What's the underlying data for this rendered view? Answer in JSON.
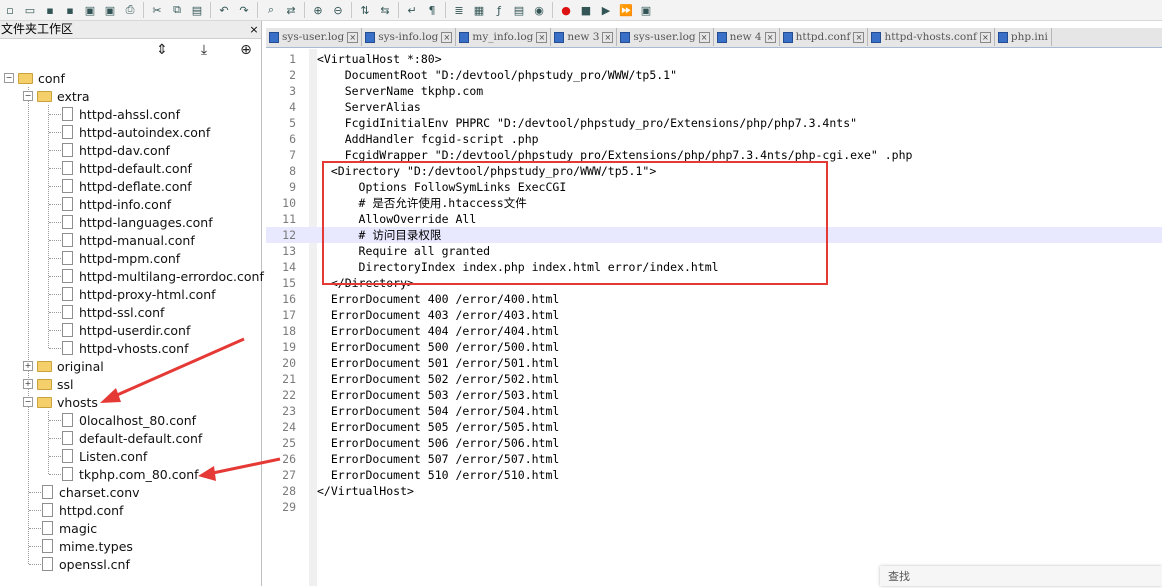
{
  "toolbar": {
    "icons": [
      "new-file-icon",
      "open-file-icon",
      "save-icon",
      "save-all-icon",
      "close-icon",
      "close-all-icon",
      "print-icon",
      "cut-icon",
      "copy-icon",
      "paste-icon",
      "undo-icon",
      "redo-icon",
      "find-icon",
      "replace-icon",
      "zoom-in-icon",
      "zoom-out-icon",
      "sync-v-icon",
      "sync-h-icon",
      "word-wrap-icon",
      "show-all-icon",
      "indent-guide-icon",
      "doc-map-icon",
      "function-list-icon",
      "folder-workspace-icon",
      "monitor-icon",
      "record-macro-icon",
      "stop-macro-icon",
      "play-macro-icon",
      "run-macro-multi-icon",
      "save-macro-icon"
    ]
  },
  "panel": {
    "title": "文件夹工作区",
    "close": "×",
    "tools": [
      "⇕",
      "⤓",
      "⊕"
    ],
    "tree": [
      {
        "label": "conf",
        "type": "folder",
        "expander": "−"
      },
      {
        "label": "extra",
        "type": "folder",
        "expander": "−"
      },
      {
        "label": "httpd-ahssl.conf",
        "type": "file"
      },
      {
        "label": "httpd-autoindex.conf",
        "type": "file"
      },
      {
        "label": "httpd-dav.conf",
        "type": "file"
      },
      {
        "label": "httpd-default.conf",
        "type": "file"
      },
      {
        "label": "httpd-deflate.conf",
        "type": "file"
      },
      {
        "label": "httpd-info.conf",
        "type": "file"
      },
      {
        "label": "httpd-languages.conf",
        "type": "file"
      },
      {
        "label": "httpd-manual.conf",
        "type": "file"
      },
      {
        "label": "httpd-mpm.conf",
        "type": "file"
      },
      {
        "label": "httpd-multilang-errordoc.conf",
        "type": "file"
      },
      {
        "label": "httpd-proxy-html.conf",
        "type": "file"
      },
      {
        "label": "httpd-ssl.conf",
        "type": "file"
      },
      {
        "label": "httpd-userdir.conf",
        "type": "file"
      },
      {
        "label": "httpd-vhosts.conf",
        "type": "file"
      },
      {
        "label": "original",
        "type": "folder",
        "expander": "+"
      },
      {
        "label": "ssl",
        "type": "folder",
        "expander": "+"
      },
      {
        "label": "vhosts",
        "type": "folder",
        "expander": "−"
      },
      {
        "label": "0localhost_80.conf",
        "type": "file"
      },
      {
        "label": "default-default.conf",
        "type": "file"
      },
      {
        "label": "Listen.conf",
        "type": "file"
      },
      {
        "label": "tkphp.com_80.conf",
        "type": "file"
      },
      {
        "label": "charset.conv",
        "type": "file"
      },
      {
        "label": "httpd.conf",
        "type": "file"
      },
      {
        "label": "magic",
        "type": "file"
      },
      {
        "label": "mime.types",
        "type": "file"
      },
      {
        "label": "openssl.cnf",
        "type": "file"
      }
    ]
  },
  "tabs": [
    {
      "label": "sys-user.log"
    },
    {
      "label": "sys-info.log"
    },
    {
      "label": "my_info.log"
    },
    {
      "label": "new 3"
    },
    {
      "label": "sys-user.log"
    },
    {
      "label": "new 4"
    },
    {
      "label": "httpd.conf"
    },
    {
      "label": "httpd-vhosts.conf"
    },
    {
      "label": "php.ini"
    }
  ],
  "tab_close": "×",
  "editor": {
    "current_line": 12,
    "lines": [
      {
        "n": "1",
        "text": "<VirtualHost *:80>"
      },
      {
        "n": "2",
        "text": "    DocumentRoot \"D:/devtool/phpstudy_pro/WWW/tp5.1\""
      },
      {
        "n": "3",
        "text": "    ServerName tkphp.com"
      },
      {
        "n": "4",
        "text": "    ServerAlias"
      },
      {
        "n": "5",
        "text": "    FcgidInitialEnv PHPRC \"D:/devtool/phpstudy_pro/Extensions/php/php7.3.4nts\""
      },
      {
        "n": "6",
        "text": "    AddHandler fcgid-script .php"
      },
      {
        "n": "7",
        "text": "    FcgidWrapper \"D:/devtool/phpstudy_pro/Extensions/php/php7.3.4nts/php-cgi.exe\" .php"
      },
      {
        "n": "8",
        "text": "  <Directory \"D:/devtool/phpstudy_pro/WWW/tp5.1\">"
      },
      {
        "n": "9",
        "text": "      Options FollowSymLinks ExecCGI"
      },
      {
        "n": "10",
        "text": "      # 是否允许使用.htaccess文件"
      },
      {
        "n": "11",
        "text": "      AllowOverride All"
      },
      {
        "n": "12",
        "text": "      # 访问目录权限"
      },
      {
        "n": "13",
        "text": "      Require all granted"
      },
      {
        "n": "14",
        "text": "      DirectoryIndex index.php index.html error/index.html"
      },
      {
        "n": "15",
        "text": "  </Directory>"
      },
      {
        "n": "16",
        "text": "  ErrorDocument 400 /error/400.html"
      },
      {
        "n": "17",
        "text": "  ErrorDocument 403 /error/403.html"
      },
      {
        "n": "18",
        "text": "  ErrorDocument 404 /error/404.html"
      },
      {
        "n": "19",
        "text": "  ErrorDocument 500 /error/500.html"
      },
      {
        "n": "20",
        "text": "  ErrorDocument 501 /error/501.html"
      },
      {
        "n": "21",
        "text": "  ErrorDocument 502 /error/502.html"
      },
      {
        "n": "22",
        "text": "  ErrorDocument 503 /error/503.html"
      },
      {
        "n": "23",
        "text": "  ErrorDocument 504 /error/504.html"
      },
      {
        "n": "24",
        "text": "  ErrorDocument 505 /error/505.html"
      },
      {
        "n": "25",
        "text": "  ErrorDocument 506 /error/506.html"
      },
      {
        "n": "26",
        "text": "  ErrorDocument 507 /error/507.html"
      },
      {
        "n": "27",
        "text": "  ErrorDocument 510 /error/510.html"
      },
      {
        "n": "28",
        "text": "</VirtualHost>"
      },
      {
        "n": "29",
        "text": ""
      }
    ]
  },
  "findbar": {
    "label": "查找"
  },
  "colors": {
    "highlight_box": "#e53935",
    "arrow": "#e53935",
    "current_line": "#e8e8ff",
    "tab_icon": "#3a6fc8",
    "folder": "#f5cf6a"
  }
}
